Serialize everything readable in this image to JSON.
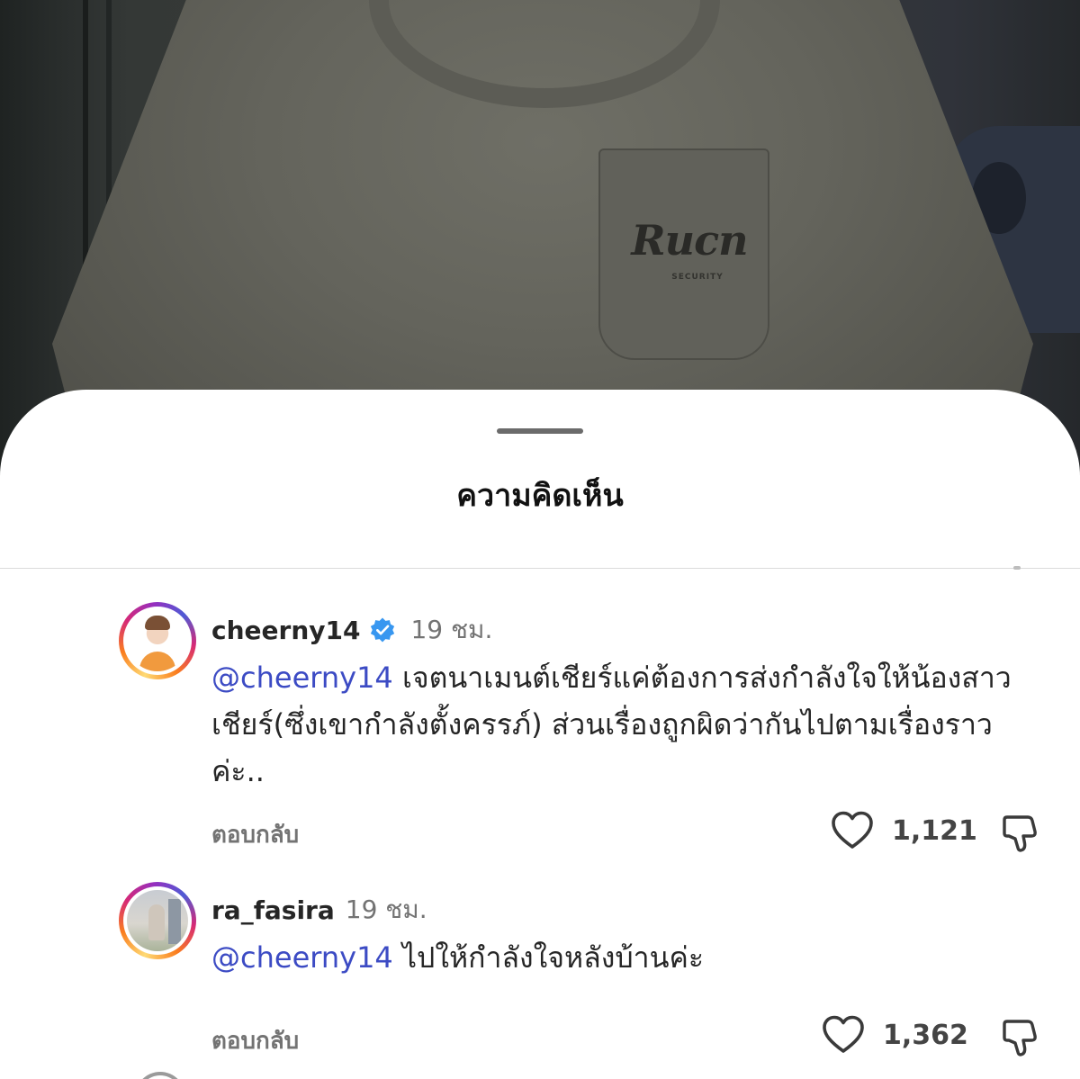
{
  "video": {
    "shirt_logo": "Rucn",
    "shirt_logo_sub": "SECURITY"
  },
  "sheet": {
    "title": "ความคิดเห็น"
  },
  "comments": [
    {
      "username": "cheerny14",
      "verified": true,
      "time": "19 ชม.",
      "mention": "@cheerny14",
      "text": " เจตนาเมนต์เชียร์แค่ต้องการส่งกำลังใจให้น้องสาวเชียร์(ซึ่งเขากำลังตั้งครรภ์) ส่วนเรื่องถูกผิดว่ากันไปตามเรื่องราวค่ะ..",
      "reply_label": "ตอบกลับ",
      "likes": "1,121"
    },
    {
      "username": "ra_fasira",
      "verified": false,
      "time": "19 ชม.",
      "mention": "@cheerny14",
      "text": " ไปให้กำลังใจหลังบ้านค่ะ",
      "reply_label": "ตอบกลับ",
      "likes": "1,362"
    }
  ],
  "colors": {
    "mention": "#3c4bc4",
    "verified_badge": "#3897f0",
    "muted_text": "#737373"
  },
  "icons": {
    "verified": "verified-badge-icon",
    "like": "heart-icon",
    "dislike": "thumbs-down-icon"
  }
}
